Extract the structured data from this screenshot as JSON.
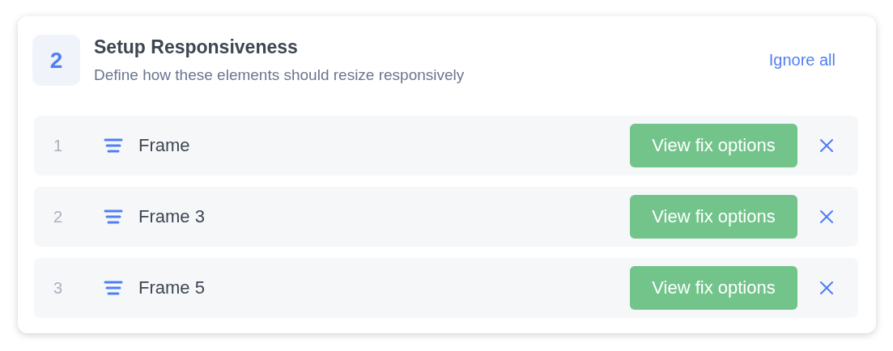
{
  "step": {
    "number": "2",
    "title": "Setup Responsiveness",
    "subtitle": "Define how these elements should resize responsively",
    "action": "Ignore all"
  },
  "items": [
    {
      "index": "1",
      "name": "Frame",
      "button": "View fix options"
    },
    {
      "index": "2",
      "name": "Frame 3",
      "button": "View fix options"
    },
    {
      "index": "3",
      "name": "Frame 5",
      "button": "View fix options"
    }
  ]
}
